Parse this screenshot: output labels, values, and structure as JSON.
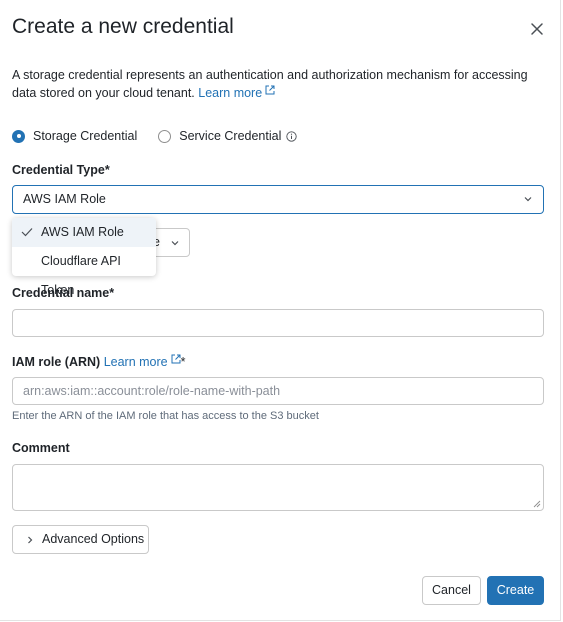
{
  "dialog": {
    "title": "Create a new credential",
    "description": "A storage credential represents an authentication and authorization mechanism for accessing data stored on your cloud tenant.",
    "learn_more": "Learn more"
  },
  "credential_kind": {
    "storage_label": "Storage Credential",
    "service_label": "Service Credential",
    "selected": "storage"
  },
  "credential_type": {
    "label": "Credential Type*",
    "value": "AWS IAM Role",
    "options": [
      "AWS IAM Role",
      "Cloudflare API Token"
    ],
    "obscured_button_text": "e"
  },
  "credential_name": {
    "label": "Credential name*",
    "value": ""
  },
  "iam_role": {
    "label": "IAM role (ARN)",
    "learn_more": "Learn more",
    "required_mark": "*",
    "placeholder": "arn:aws:iam::account:role/role-name-with-path",
    "hint": "Enter the ARN of the IAM role that has access to the S3 bucket"
  },
  "comment": {
    "label": "Comment",
    "value": ""
  },
  "advanced": {
    "label": "Advanced Options"
  },
  "actions": {
    "cancel": "Cancel",
    "create": "Create"
  },
  "colors": {
    "accent": "#2272b4",
    "border": "#c9c9c9",
    "hint": "#5f6b7a"
  }
}
